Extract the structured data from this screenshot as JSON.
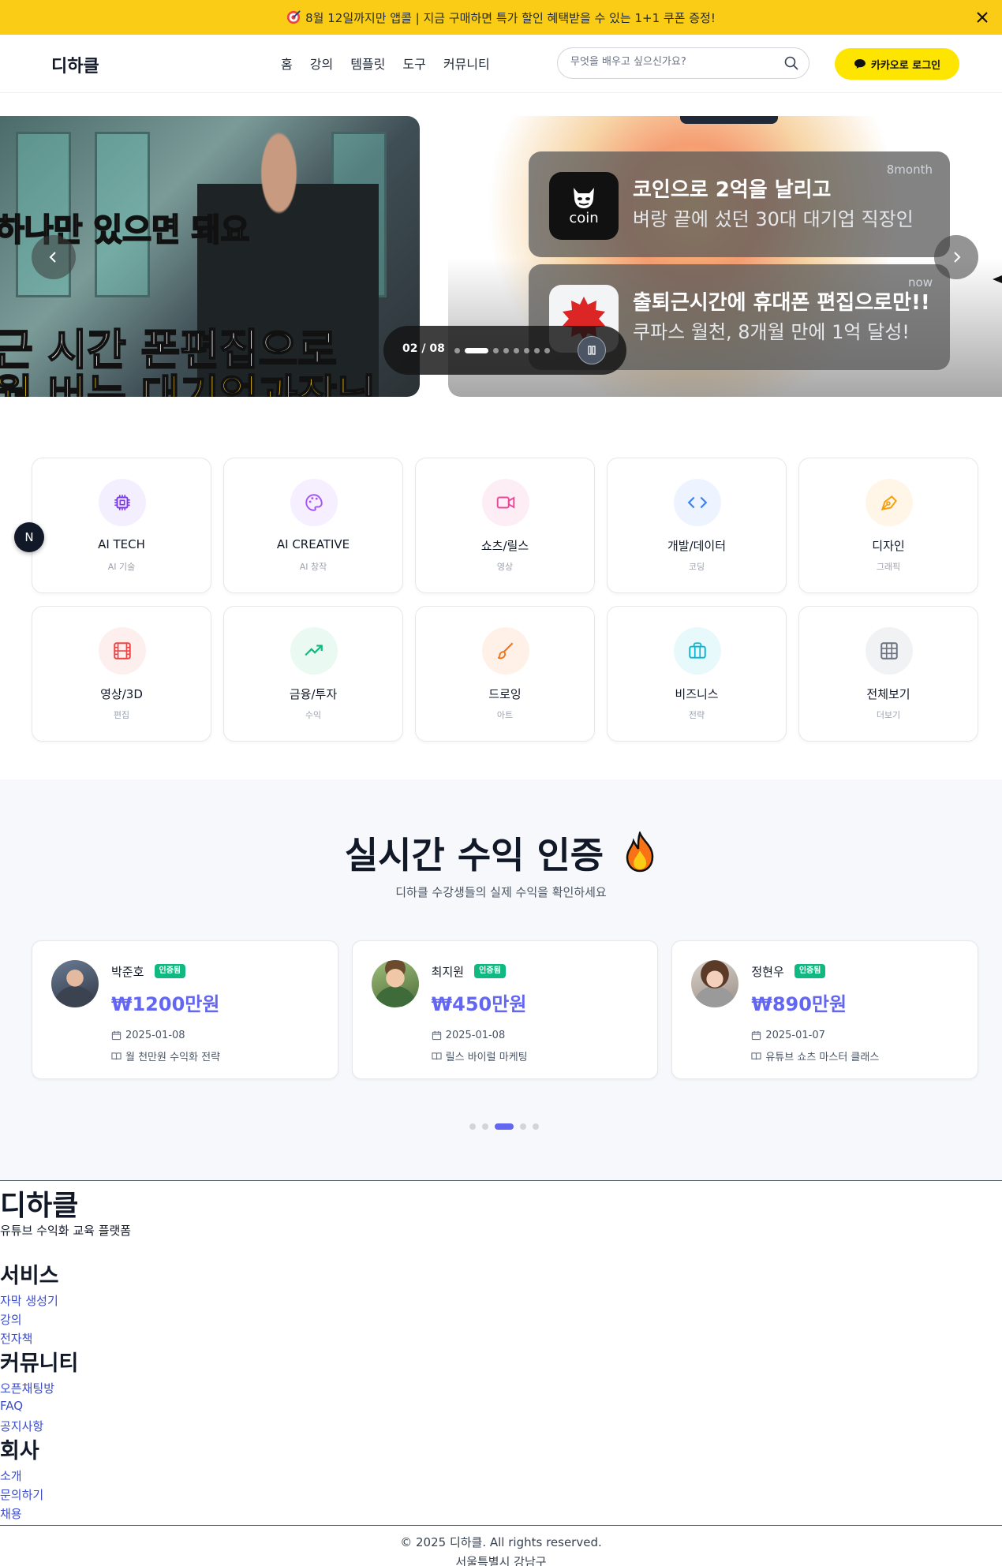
{
  "promo": {
    "text": "8월 12일까지만 앱콜 | 지금 구매하면 특가 할인 혜택받을 수 있는 1+1 쿠폰 증정!",
    "color": "#FACC15"
  },
  "header": {
    "logo": "디하클",
    "nav": [
      "홈",
      "강의",
      "템플릿",
      "도구",
      "커뮤니티"
    ],
    "search_placeholder": "무엇을 배우고 싶으신가요?",
    "login_label": "카카오로 로그인"
  },
  "hero": {
    "left_caption_1": "하나만 있으면 돼요",
    "left_caption_2": "근 시간 폰편집으로",
    "left_caption_3": "월 버는 대기업과장님",
    "notifications": [
      {
        "icon_label": "coin",
        "title": "코인으로 2억을 날리고",
        "body": "벼랑 끝에 섰던 30대 대기업 직장인",
        "time": "8month"
      },
      {
        "icon_label": "",
        "title": "출퇴근시간에 휴대폰 편집으로만!!",
        "body": "쿠파스 월천, 8개월 만에 1억 달성!",
        "time": "now"
      }
    ],
    "counter": "02 / 08",
    "slide_count": 8,
    "active_slide": 2
  },
  "floating_badge": "N",
  "categories": [
    {
      "name": "AI TECH",
      "sub": "AI 기술",
      "icon": "chip-icon",
      "color": "#7c3aed",
      "bg": "#f3efff"
    },
    {
      "name": "AI CREATIVE",
      "sub": "AI 창작",
      "icon": "palette-icon",
      "color": "#a855f7",
      "bg": "#f5efff"
    },
    {
      "name": "쇼츠/릴스",
      "sub": "영상",
      "icon": "video-icon",
      "color": "#ec4899",
      "bg": "#fdeef5"
    },
    {
      "name": "개발/데이터",
      "sub": "코딩",
      "icon": "code-icon",
      "color": "#3b82f6",
      "bg": "#eef4ff"
    },
    {
      "name": "디자인",
      "sub": "그래픽",
      "icon": "pen-tool-icon",
      "color": "#f59e0b",
      "bg": "#fff6e8"
    },
    {
      "name": "영상/3D",
      "sub": "편집",
      "icon": "film-icon",
      "color": "#ef4444",
      "bg": "#feefef"
    },
    {
      "name": "금융/투자",
      "sub": "수익",
      "icon": "trending-up-icon",
      "color": "#10b981",
      "bg": "#eafaf3"
    },
    {
      "name": "드로잉",
      "sub": "아트",
      "icon": "brush-icon",
      "color": "#f97316",
      "bg": "#fff1e8"
    },
    {
      "name": "비즈니스",
      "sub": "전략",
      "icon": "briefcase-icon",
      "color": "#06b6d4",
      "bg": "#e8f9fc"
    },
    {
      "name": "전체보기",
      "sub": "더보기",
      "icon": "grid-icon",
      "color": "#6b7280",
      "bg": "#f1f2f4"
    }
  ],
  "revenue": {
    "title": "실시간 수익 인증",
    "subtitle": "디하클 수강생들의 실제 수익을 확인하세요",
    "badge_label": "인증됨",
    "cards": [
      {
        "name": "박준호",
        "amount": "₩1200만원",
        "date": "2025-01-08",
        "course": "월 천만원 수익화 전략"
      },
      {
        "name": "최지원",
        "amount": "₩450만원",
        "date": "2025-01-08",
        "course": "릴스 바이럴 마케팅"
      },
      {
        "name": "정현우",
        "amount": "₩890만원",
        "date": "2025-01-07",
        "course": "유튜브 쇼츠 마스터 클래스"
      }
    ],
    "page_count": 5,
    "active_page": 3,
    "accent": "#6366f1"
  },
  "footer": {
    "logo": "디하클",
    "tagline": "유튜브 수익화 교육 플랫폼",
    "sections": [
      {
        "title": "서비스",
        "links": [
          "자막 생성기",
          "강의",
          "전자책"
        ]
      },
      {
        "title": "커뮤니티",
        "links": [
          "오픈채팅방",
          "FAQ",
          "공지사항"
        ]
      },
      {
        "title": "회사",
        "links": [
          "소개",
          "문의하기",
          "채용"
        ]
      }
    ],
    "copyright": "© 2025 디하클. All rights reserved.",
    "address": "서울특별시 강남구"
  }
}
